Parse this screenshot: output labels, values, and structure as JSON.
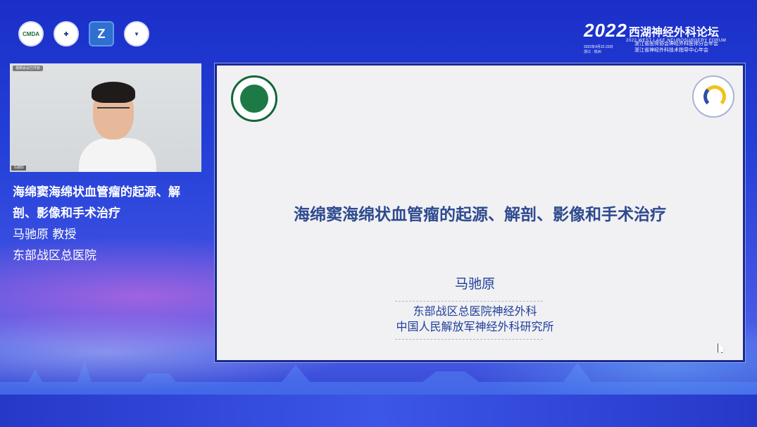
{
  "header": {
    "logos": [
      {
        "name": "cmda-logo",
        "text": "CMDA"
      },
      {
        "name": "society-logo",
        "text": ""
      },
      {
        "name": "z-logo",
        "text": "Z"
      },
      {
        "name": "university-logo",
        "text": ""
      }
    ],
    "forum": {
      "year": "2022",
      "title": "西湖神经外科论坛",
      "english": "2022 WEST LAKE NEUROSURGERY FORUM",
      "date": "2022年4月22-23日",
      "city": "浙江 · 杭州",
      "org_1": "浙江省医师协会神经外科医师分会年会",
      "org_2": "浙江省神经外科技术指导中心年会"
    }
  },
  "video": {
    "top_tag": "视频会议已开启",
    "name_tag": "马驰原"
  },
  "speaker": {
    "talk_title": "海绵窦海绵状血管瘤的起源、解剖、影像和手术治疗",
    "name": "马驰原  教授",
    "affiliation": "东部战区总医院"
  },
  "slide": {
    "title": "海绵窦海绵状血管瘤的起源、解剖、影像和手术治疗",
    "author": "马驰原",
    "affil_1": "东部战区总医院神经外科",
    "affil_2": "中国人民解放军神经外科研究所"
  }
}
